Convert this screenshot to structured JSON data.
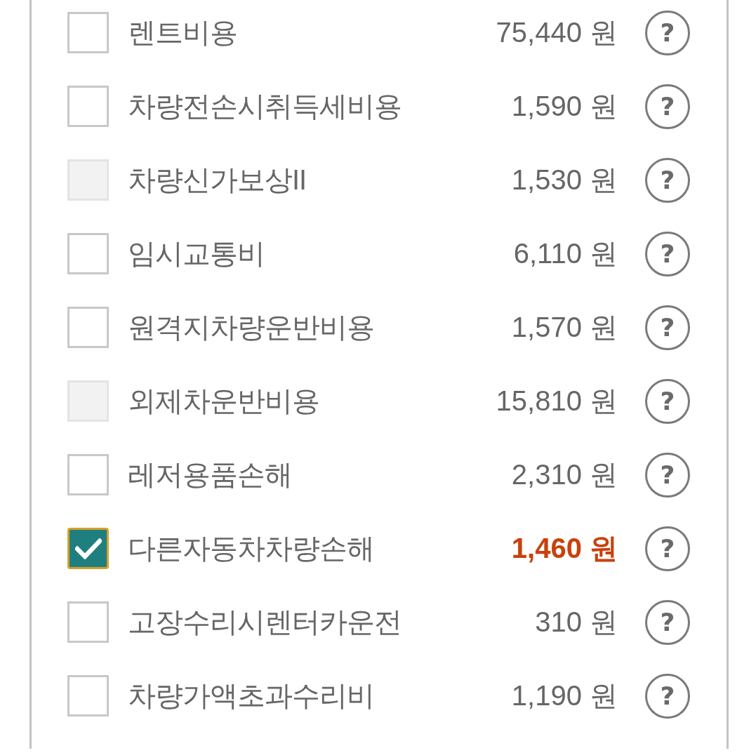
{
  "items": [
    {
      "label": "렌트비용",
      "amount": "75,440 원",
      "help": "?",
      "checked": false,
      "disabled": false
    },
    {
      "label": "차량전손시취득세비용",
      "amount": "1,590 원",
      "help": "?",
      "checked": false,
      "disabled": false
    },
    {
      "label": "차량신가보상II",
      "amount": "1,530 원",
      "help": "?",
      "checked": false,
      "disabled": true
    },
    {
      "label": "임시교통비",
      "amount": "6,110 원",
      "help": "?",
      "checked": false,
      "disabled": false
    },
    {
      "label": "원격지차량운반비용",
      "amount": "1,570 원",
      "help": "?",
      "checked": false,
      "disabled": false
    },
    {
      "label": "외제차운반비용",
      "amount": "15,810 원",
      "help": "?",
      "checked": false,
      "disabled": true
    },
    {
      "label": "레저용품손해",
      "amount": "2,310 원",
      "help": "?",
      "checked": false,
      "disabled": false
    },
    {
      "label": "다른자동차차량손해",
      "amount": "1,460 원",
      "help": "?",
      "checked": true,
      "disabled": false
    },
    {
      "label": "고장수리시렌터카운전",
      "amount": "310 원",
      "help": "?",
      "checked": false,
      "disabled": false
    },
    {
      "label": "차량가액초과수리비",
      "amount": "1,190 원",
      "help": "?",
      "checked": false,
      "disabled": false
    }
  ]
}
